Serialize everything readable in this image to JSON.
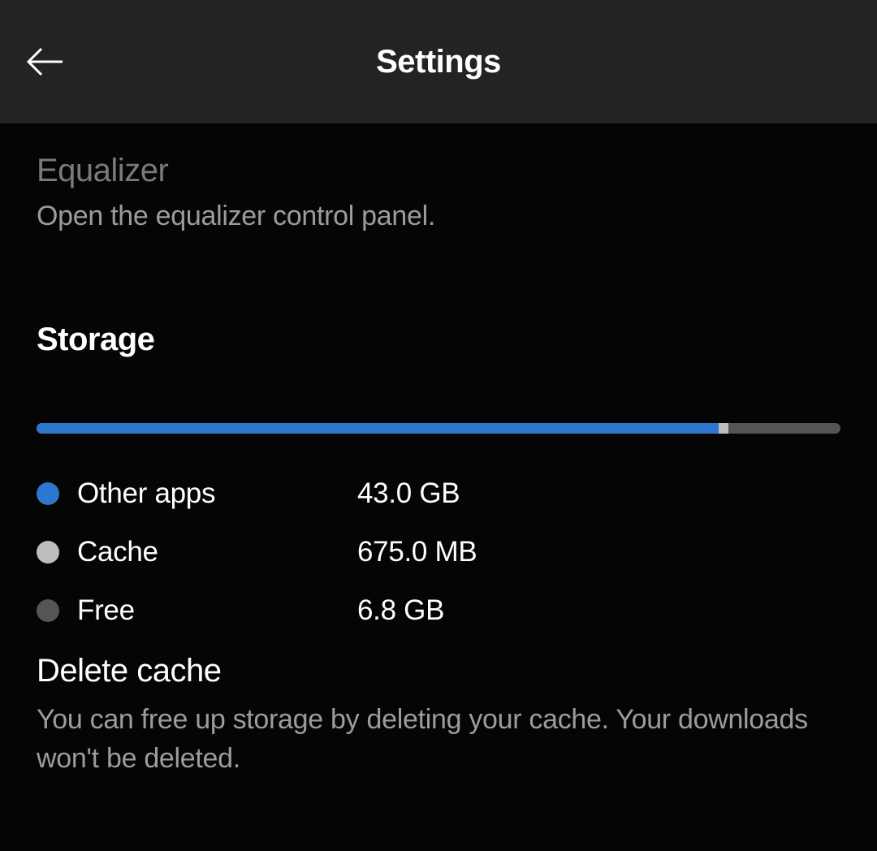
{
  "header": {
    "title": "Settings"
  },
  "equalizer": {
    "title": "Equalizer",
    "description": "Open the equalizer control panel."
  },
  "storage": {
    "section_title": "Storage",
    "bar": {
      "other_percent": 84.8,
      "cache_percent": 1.3
    },
    "legend": [
      {
        "label": "Other apps",
        "value": "43.0 GB"
      },
      {
        "label": "Cache",
        "value": "675.0 MB"
      },
      {
        "label": "Free",
        "value": "6.8 GB"
      }
    ]
  },
  "delete_cache": {
    "title": "Delete cache",
    "description": "You can free up storage by deleting your cache. Your downloads won't be deleted."
  }
}
